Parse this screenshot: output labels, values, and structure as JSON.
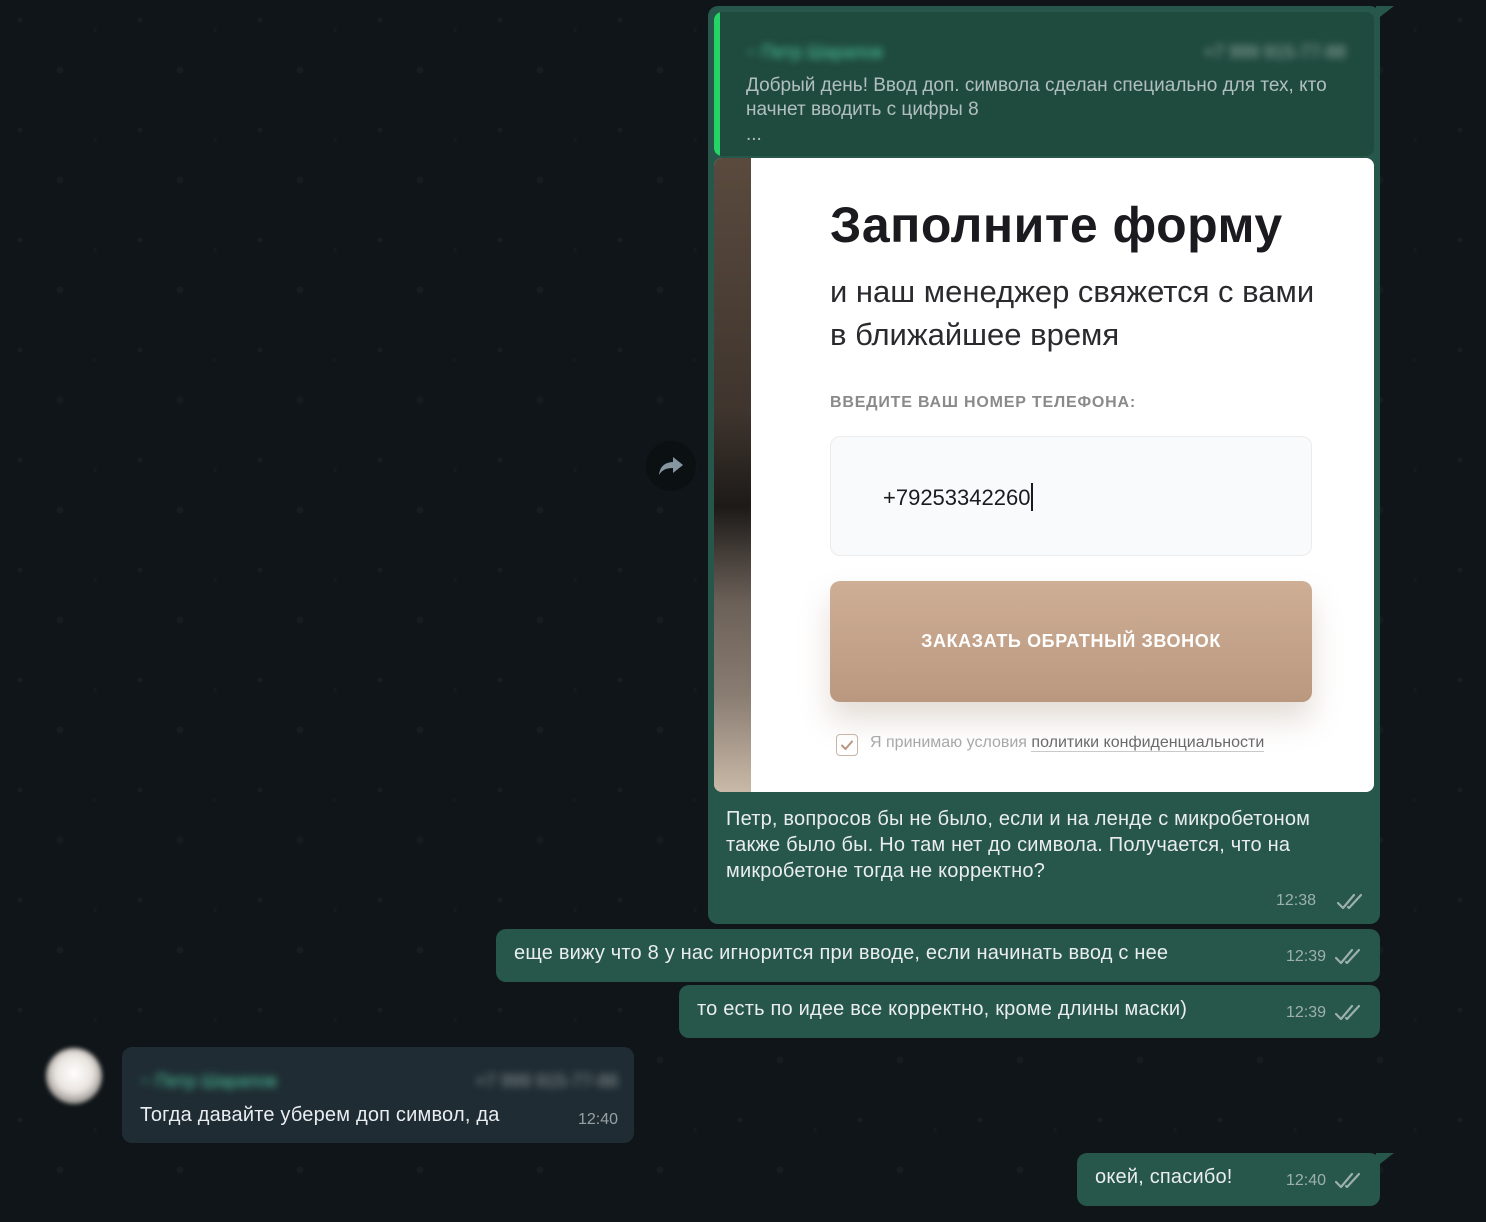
{
  "chat": {
    "big_message": {
      "quote": {
        "author": "~ Петр Шарапов",
        "phone": "+7 999 915-77-88",
        "text": "Добрый день! Ввод доп. символа сделан специально для тех, кто начнет вводить с цифры 8",
        "ellipsis": "..."
      },
      "screenshot": {
        "title": "Заполните форму",
        "subtitle": "и наш менеджер свяжется с вами в ближайшее время",
        "phone_label": "ВВЕДИТЕ ВАШ НОМЕР ТЕЛЕФОНА:",
        "phone_value": "+79253342260",
        "button_label": "ЗАКАЗАТЬ ОБРАТНЫЙ ЗВОНОК",
        "consent_text": "Я принимаю условия",
        "consent_link": "политики конфиденциальности"
      },
      "text": "Петр, вопросов бы не было, если и на ленде с микробетоном также было бы. Но там нет до символа. Получается, что на микробетоне тогда не корректно?",
      "time": "12:38"
    },
    "messages": [
      {
        "text": "еще вижу что 8 у нас игнорится при вводе, если начинать ввод с нее",
        "time": "12:39"
      },
      {
        "text": "то есть по идее все корректно, кроме длины маски)",
        "time": "12:39"
      }
    ],
    "incoming": {
      "author": "~ Петр Шарапов",
      "phone": "+7 999 915-77-88",
      "text": "Тогда давайте уберем доп символ, да",
      "time": "12:40"
    },
    "last_message": {
      "text": "окей, спасибо!",
      "time": "12:40"
    }
  },
  "icons": {
    "forward": "forward-arrow-icon",
    "read_receipt": "double-check-icon",
    "checkbox": "check-icon"
  },
  "colors": {
    "outgoing_bubble": "#27564a",
    "incoming_bubble": "#1f2c33",
    "accent": "#25d366",
    "button": "#c3a38b"
  }
}
